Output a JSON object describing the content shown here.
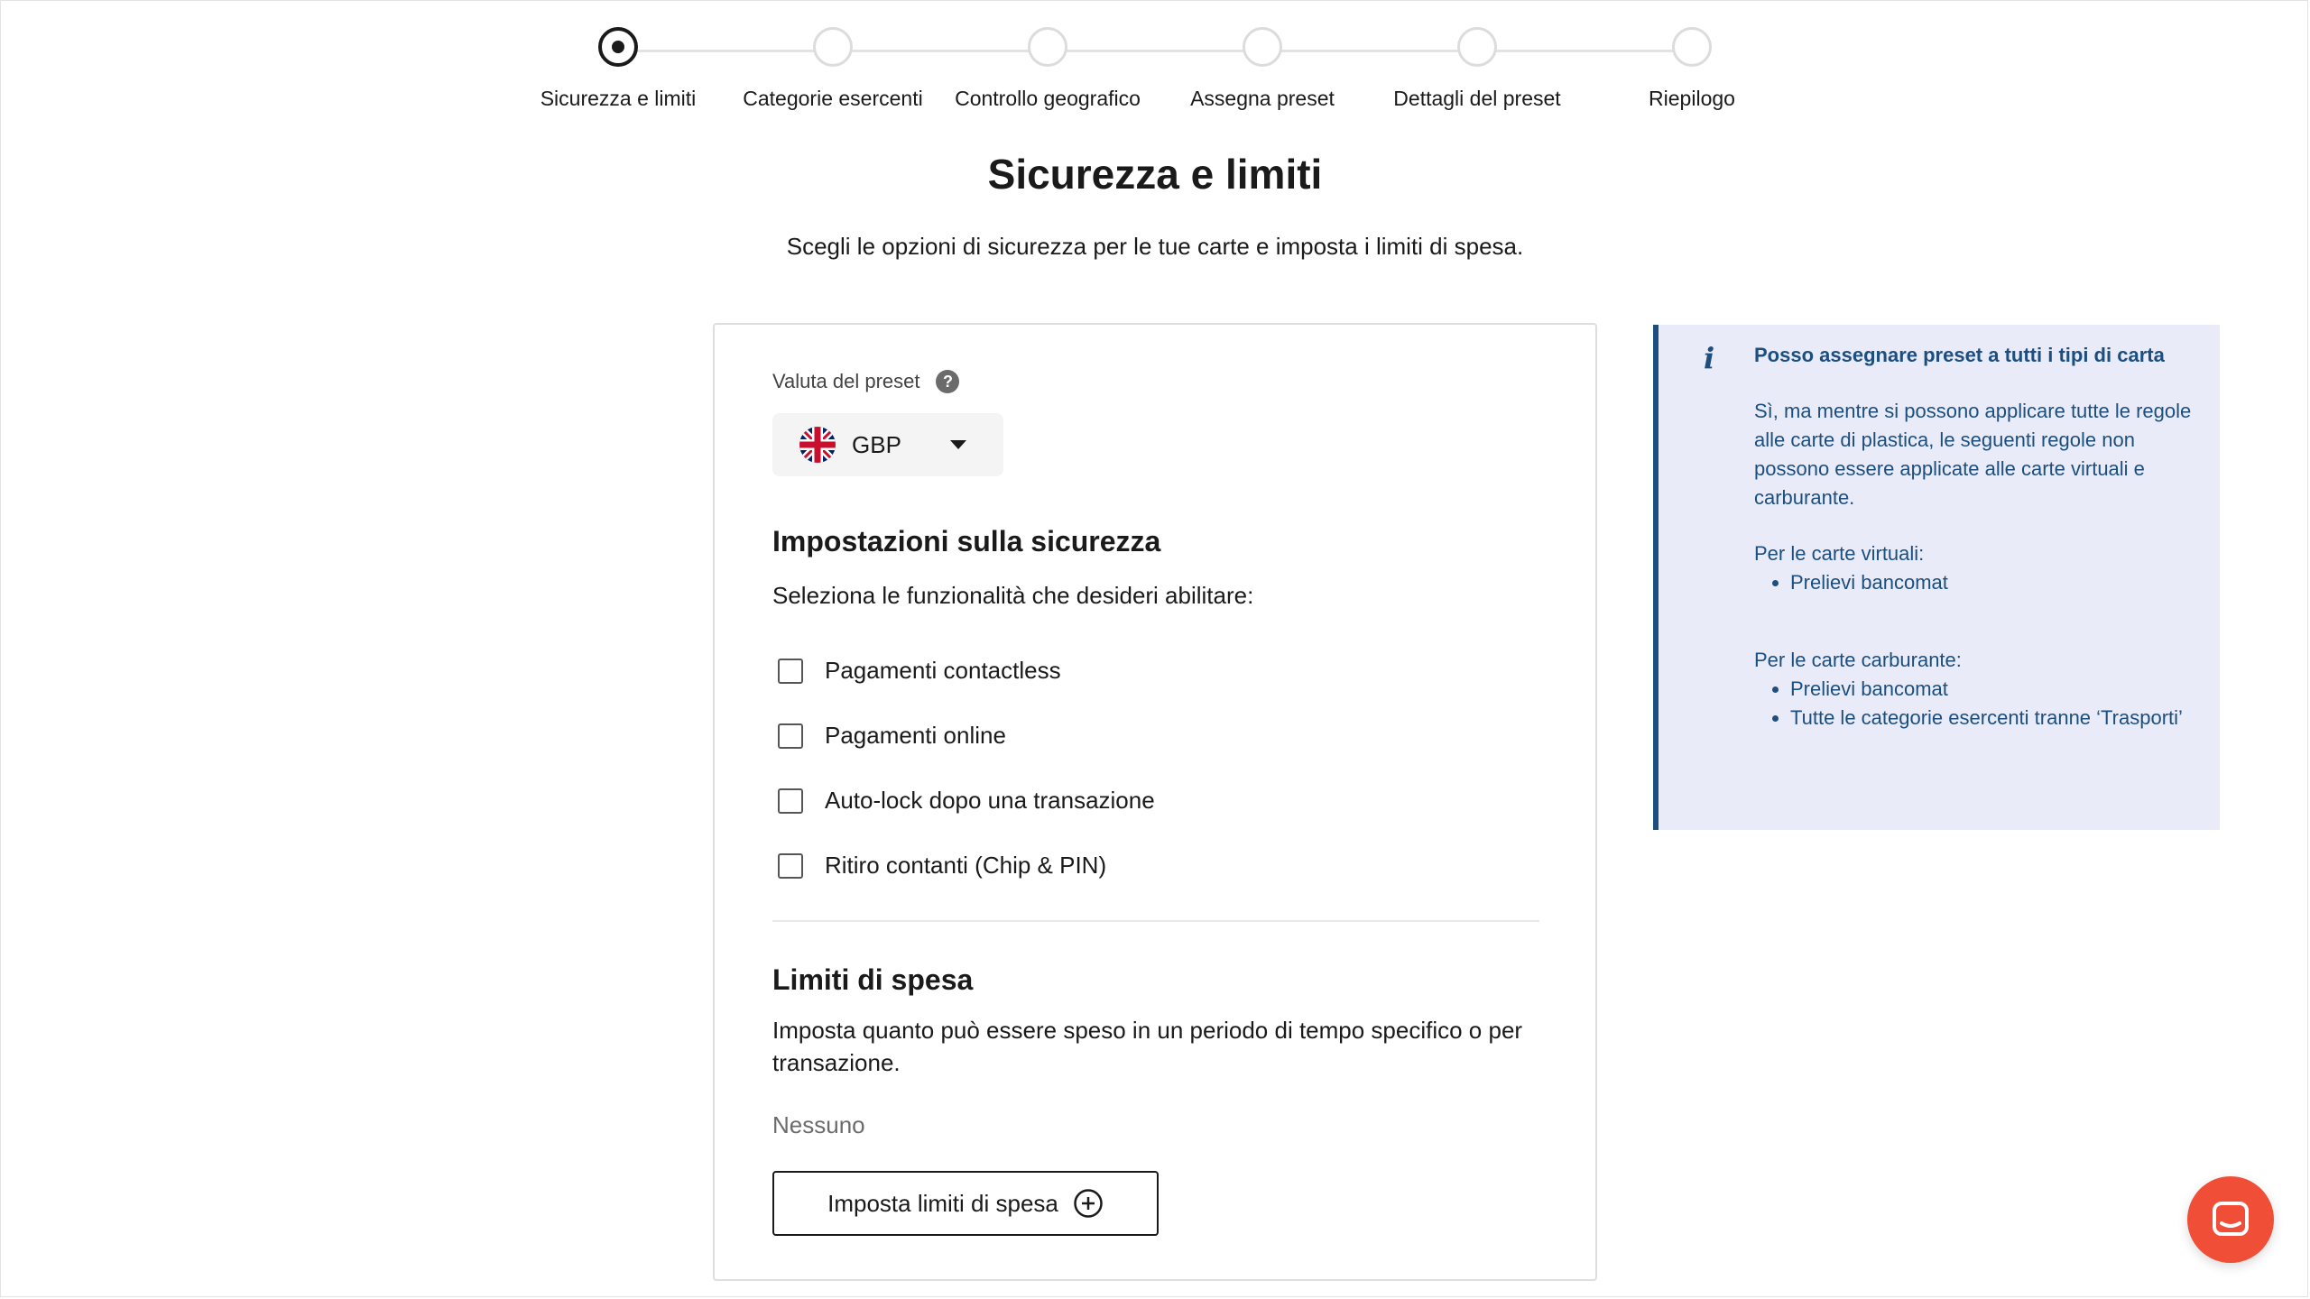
{
  "stepper": {
    "steps": [
      {
        "label": "Sicurezza e limiti",
        "active": true
      },
      {
        "label": "Categorie esercenti",
        "active": false
      },
      {
        "label": "Controllo geografico",
        "active": false
      },
      {
        "label": "Assegna preset",
        "active": false
      },
      {
        "label": "Dettagli del preset",
        "active": false
      },
      {
        "label": "Riepilogo",
        "active": false
      }
    ]
  },
  "header": {
    "title": "Sicurezza e limiti",
    "subtitle": "Scegli le opzioni di sicurezza per le tue carte e imposta i limiti di spesa."
  },
  "currency": {
    "label": "Valuta del preset",
    "help_glyph": "?",
    "value": "GBP",
    "flag_icon": "uk-flag-icon"
  },
  "security": {
    "title": "Impostazioni sulla sicurezza",
    "description": "Seleziona le funzionalità che desideri abilitare:",
    "options": [
      {
        "label": "Pagamenti contactless",
        "checked": false
      },
      {
        "label": "Pagamenti online",
        "checked": false
      },
      {
        "label": "Auto-lock dopo una transazione",
        "checked": false
      },
      {
        "label": "Ritiro contanti (Chip & PIN)",
        "checked": false
      }
    ]
  },
  "limits": {
    "title": "Limiti di spesa",
    "description": "Imposta quanto può essere speso in un periodo di tempo specifico o per transazione.",
    "none_text": "Nessuno",
    "button_label": "Imposta limiti di spesa"
  },
  "info": {
    "icon_glyph": "i",
    "title": "Posso assegnare preset a tutti i tipi di carta",
    "text": "Sì, ma mentre si possono applicare tutte le regole alle carte di plastica, le seguenti regole non possono essere applicate alle carte virtuali e carburante.",
    "virtual_heading": "Per le carte virtuali:",
    "virtual_items": [
      "Prelievi bancomat"
    ],
    "fuel_heading": "Per le carte carburante:",
    "fuel_items": [
      "Prelievi bancomat",
      "Tutte le categorie esercenti tranne ‘Trasporti’"
    ]
  },
  "colors": {
    "info_accent": "#1c4e80",
    "info_background": "#e9ecf8",
    "chat_launcher": "#f04e37"
  }
}
